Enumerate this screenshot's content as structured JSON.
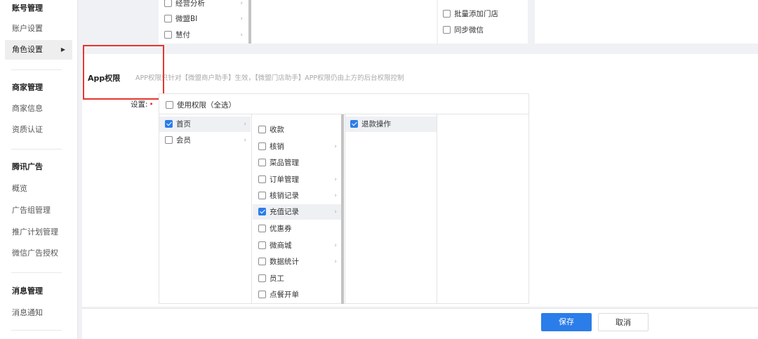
{
  "sidebar": {
    "items": [
      {
        "label": "账号管理"
      },
      {
        "label": "账户设置"
      },
      {
        "label": "角色设置"
      },
      {
        "label": "商家管理"
      },
      {
        "label": "商家信息"
      },
      {
        "label": "资质认证"
      },
      {
        "label": "腾讯广告"
      },
      {
        "label": "概览"
      },
      {
        "label": "广告组管理"
      },
      {
        "label": "推广计划管理"
      },
      {
        "label": "微信广告授权"
      },
      {
        "label": "消息管理"
      },
      {
        "label": "消息通知"
      }
    ]
  },
  "top_panel": {
    "col1": [
      "经营分析",
      "微盟BI",
      "慧付"
    ],
    "col3": [
      "批量添加门店",
      "同步微信"
    ]
  },
  "app_section": {
    "title": "App权限",
    "description": "APP权限只针对【微盟商户助手】生效，【微盟门店助手】APP权限仍由上方的后台权限控制",
    "setting_label": "设置:",
    "required_mark": "•",
    "select_all": "使用权限（全选）",
    "col1": [
      {
        "label": "首页",
        "checked": true
      },
      {
        "label": "会员",
        "checked": false
      }
    ],
    "col2": [
      {
        "label": "收款",
        "checked": false
      },
      {
        "label": "核销",
        "checked": false
      },
      {
        "label": "菜品管理",
        "checked": false
      },
      {
        "label": "订单管理",
        "checked": false
      },
      {
        "label": "核销记录",
        "checked": false
      },
      {
        "label": "充值记录",
        "checked": true
      },
      {
        "label": "优惠券",
        "checked": false
      },
      {
        "label": "微商城",
        "checked": false
      },
      {
        "label": "数据统计",
        "checked": false
      },
      {
        "label": "员工",
        "checked": false
      },
      {
        "label": "点餐开单",
        "checked": false
      }
    ],
    "col3": [
      {
        "label": "退款操作",
        "checked": true
      }
    ]
  },
  "footer": {
    "save_label": "保存",
    "cancel_label": "取消"
  },
  "colors": {
    "accent": "#2b7de9",
    "highlight_box": "#e8342e"
  }
}
